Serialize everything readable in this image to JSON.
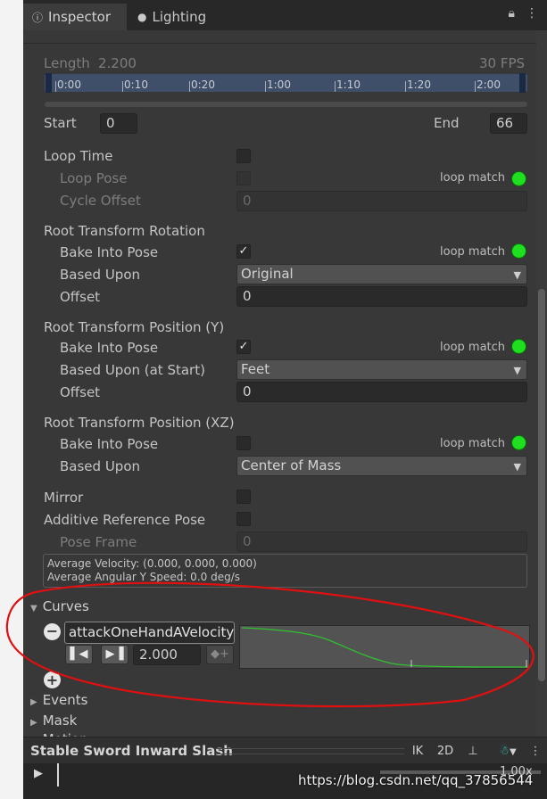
{
  "tabs": [
    {
      "label": "Inspector",
      "icon": "info-icon"
    },
    {
      "label": "Lighting",
      "icon": "lightbulb-icon"
    }
  ],
  "clip": {
    "length_label": "Length",
    "length_value": "2.200",
    "fps": "30 FPS",
    "timeline_ticks": [
      "0:00",
      "0:10",
      "0:20",
      "1:00",
      "1:10",
      "1:20",
      "2:00"
    ],
    "start_label": "Start",
    "start_value": "0",
    "end_label": "End",
    "end_value": "66"
  },
  "loop": {
    "loop_time": "Loop Time",
    "loop_pose": "Loop Pose",
    "cycle_offset": "Cycle Offset",
    "cycle_offset_value": "0",
    "loop_match": "loop match"
  },
  "root_rotation": {
    "title": "Root Transform Rotation",
    "bake": "Bake Into Pose",
    "based_upon": "Based Upon",
    "based_upon_value": "Original",
    "offset": "Offset",
    "offset_value": "0",
    "loop_match": "loop match"
  },
  "root_pos_y": {
    "title": "Root Transform Position (Y)",
    "bake": "Bake Into Pose",
    "based_upon": "Based Upon (at Start)",
    "based_upon_value": "Feet",
    "offset": "Offset",
    "offset_value": "0",
    "loop_match": "loop match"
  },
  "root_pos_xz": {
    "title": "Root Transform Position (XZ)",
    "bake": "Bake Into Pose",
    "based_upon": "Based Upon",
    "based_upon_value": "Center of Mass",
    "loop_match": "loop match"
  },
  "misc": {
    "mirror": "Mirror",
    "additive": "Additive Reference Pose",
    "pose_frame": "Pose Frame",
    "pose_frame_value": "0",
    "avg_velocity": "Average Velocity: (0.000, 0.000, 0.000)",
    "avg_angular": "Average Angular Y Speed: 0.0 deg/s"
  },
  "curves": {
    "title": "Curves",
    "curve_name": "attackOneHandAVelocity",
    "value": "2.000"
  },
  "sections": {
    "events": "Events",
    "mask": "Mask",
    "motion": "Motion"
  },
  "bottom": {
    "title": "Stable Sword Inward Slash",
    "ik": "IK",
    "twod": "2D",
    "speed": "1.00x"
  },
  "watermark": "https://blog.csdn.net/qq_37856544",
  "colors": {
    "loop_match_dot": "#1ee01e",
    "annotation": "#e01010",
    "curve_line": "#2fc12f"
  }
}
